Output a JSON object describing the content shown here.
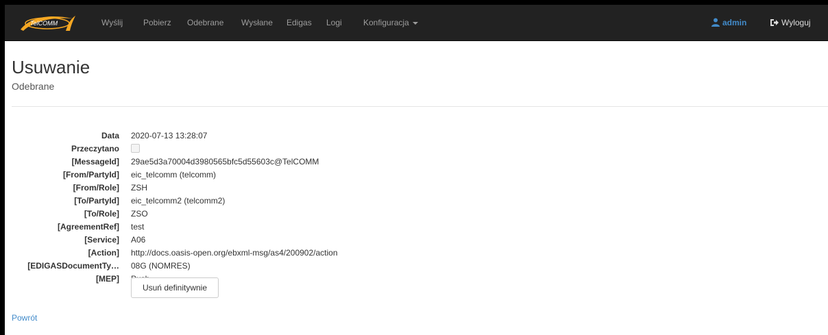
{
  "navbar": {
    "brand": "TelCOMM",
    "items": [
      "Wyślij",
      "Pobierz",
      "Odebrane",
      "Wysłane",
      "Edigas",
      "Logi"
    ],
    "dropdown_label": "Konfiguracja",
    "user_label": "admin",
    "logout_label": "Wyloguj"
  },
  "page": {
    "title": "Usuwanie",
    "subtitle": "Odebrane"
  },
  "details": [
    {
      "label": "Data",
      "value": "2020-07-13 13:28:07"
    },
    {
      "label": "Przeczytano",
      "value": ""
    },
    {
      "label": "[MessageId]",
      "value": "29ae5d3a70004d3980565bfc5d55603c@TelCOMM"
    },
    {
      "label": "[From/PartyId]",
      "value": "eic_telcomm (telcomm)"
    },
    {
      "label": "[From/Role]",
      "value": "ZSH"
    },
    {
      "label": "[To/PartyId]",
      "value": "eic_telcomm2 (telcomm2)"
    },
    {
      "label": "[To/Role]",
      "value": "ZSO"
    },
    {
      "label": "[AgreementRef]",
      "value": "test"
    },
    {
      "label": "[Service]",
      "value": "A06"
    },
    {
      "label": "[Action]",
      "value": "http://docs.oasis-open.org/ebxml-msg/as4/200902/action"
    },
    {
      "label": "[EDIGASDocumentTy…",
      "value": "08G (NOMRES)"
    },
    {
      "label": "[MEP]",
      "value": "Push"
    }
  ],
  "delete_button_label": "Usuń definitywnie",
  "back_link_label": "Powrót",
  "colors": {
    "navbar_bg": "#222222",
    "nav_text": "#9d9d9d",
    "link": "#428bca"
  }
}
